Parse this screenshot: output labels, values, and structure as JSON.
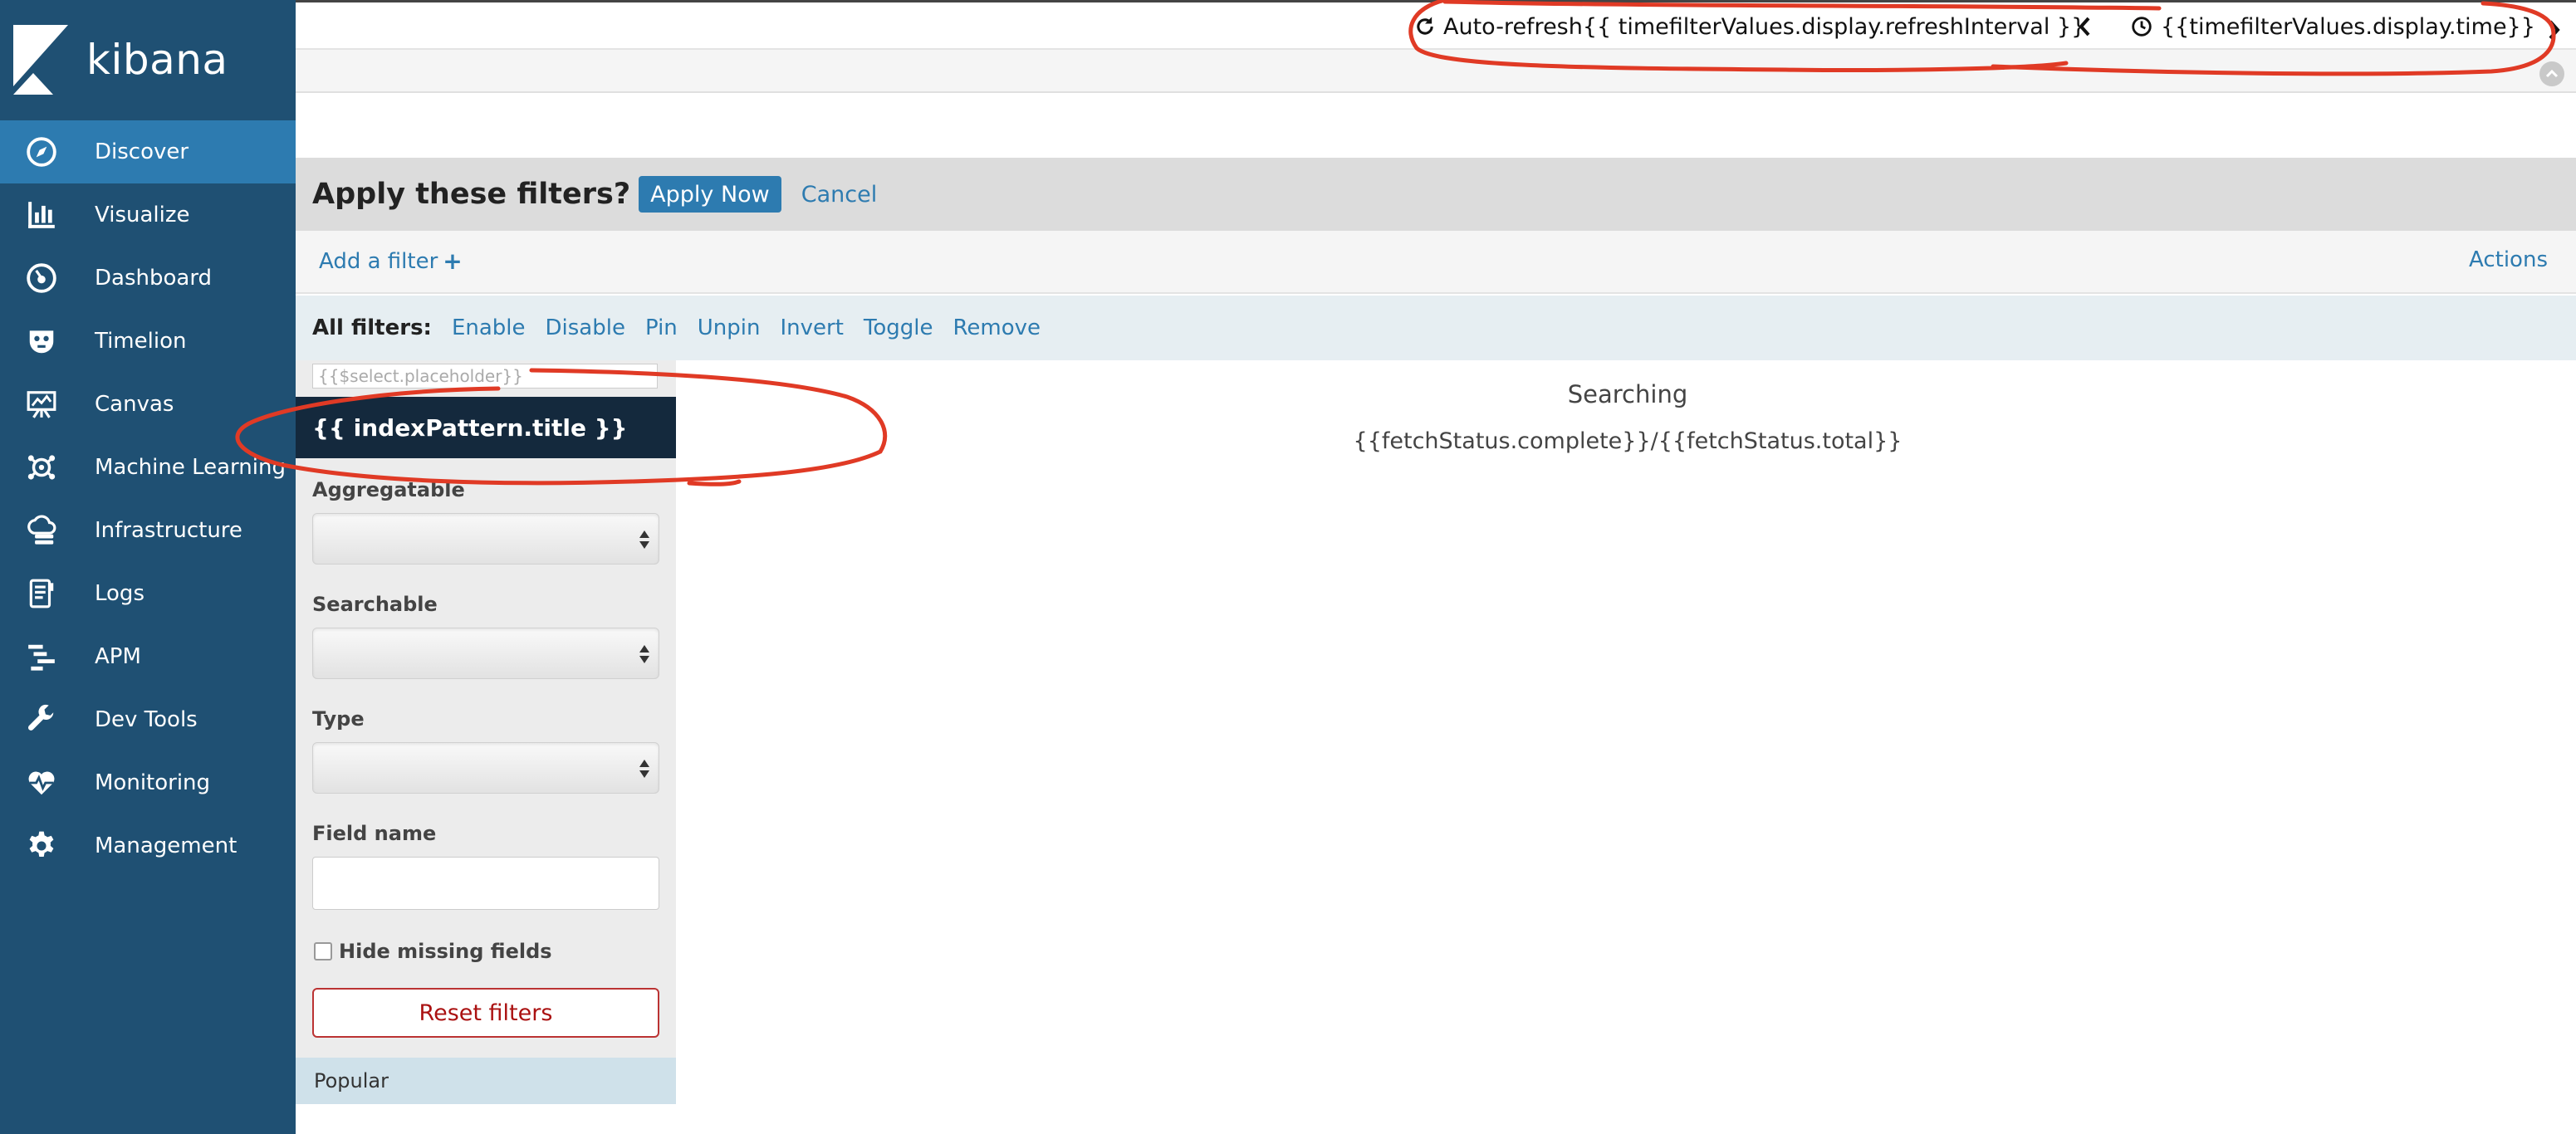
{
  "brand": {
    "name": "kibana"
  },
  "sidebar": {
    "items": [
      {
        "label": "Discover",
        "icon": "compass-icon",
        "active": true
      },
      {
        "label": "Visualize",
        "icon": "bar-chart-icon"
      },
      {
        "label": "Dashboard",
        "icon": "dashboard-gauge-icon"
      },
      {
        "label": "Timelion",
        "icon": "timelion-mask-icon"
      },
      {
        "label": "Canvas",
        "icon": "canvas-easel-icon"
      },
      {
        "label": "Machine Learning",
        "icon": "machine-learning-icon"
      },
      {
        "label": "Infrastructure",
        "icon": "infrastructure-icon"
      },
      {
        "label": "Logs",
        "icon": "logs-icon"
      },
      {
        "label": "APM",
        "icon": "apm-icon"
      },
      {
        "label": "Dev Tools",
        "icon": "wrench-icon"
      },
      {
        "label": "Monitoring",
        "icon": "heartbeat-icon"
      },
      {
        "label": "Management",
        "icon": "gear-icon"
      }
    ]
  },
  "topbar": {
    "refresh_label": "Auto-refresh{{ timefilterValues.display.refreshInterval }}",
    "time_label": "{{timefilterValues.display.time}}"
  },
  "apply_bar": {
    "title": "Apply these filters?",
    "apply_label": "Apply Now",
    "cancel_label": "Cancel"
  },
  "filter_bar": {
    "add_filter_label": "Add a filter",
    "add_filter_plus": "+",
    "actions_label": "Actions"
  },
  "all_filters": {
    "label": "All filters:",
    "links": [
      "Enable",
      "Disable",
      "Pin",
      "Unpin",
      "Invert",
      "Toggle",
      "Remove"
    ]
  },
  "field_panel": {
    "index_select_placeholder": "{{$select.placeholder}}",
    "index_title": "{{ indexPattern.title }}",
    "aggregatable_label": "Aggregatable",
    "searchable_label": "Searchable",
    "type_label": "Type",
    "field_name_label": "Field name",
    "hide_missing_label": "Hide missing fields",
    "reset_label": "Reset filters",
    "popular_label": "Popular"
  },
  "main": {
    "searching_label": "Searching",
    "fetch_status": "{{fetchStatus.complete}}/{{fetchStatus.total}}"
  },
  "colors": {
    "sidebar_bg": "#1f5073",
    "active_item": "#2d7bb0",
    "link": "#2d7bb0",
    "annotation": "#e03a25"
  }
}
